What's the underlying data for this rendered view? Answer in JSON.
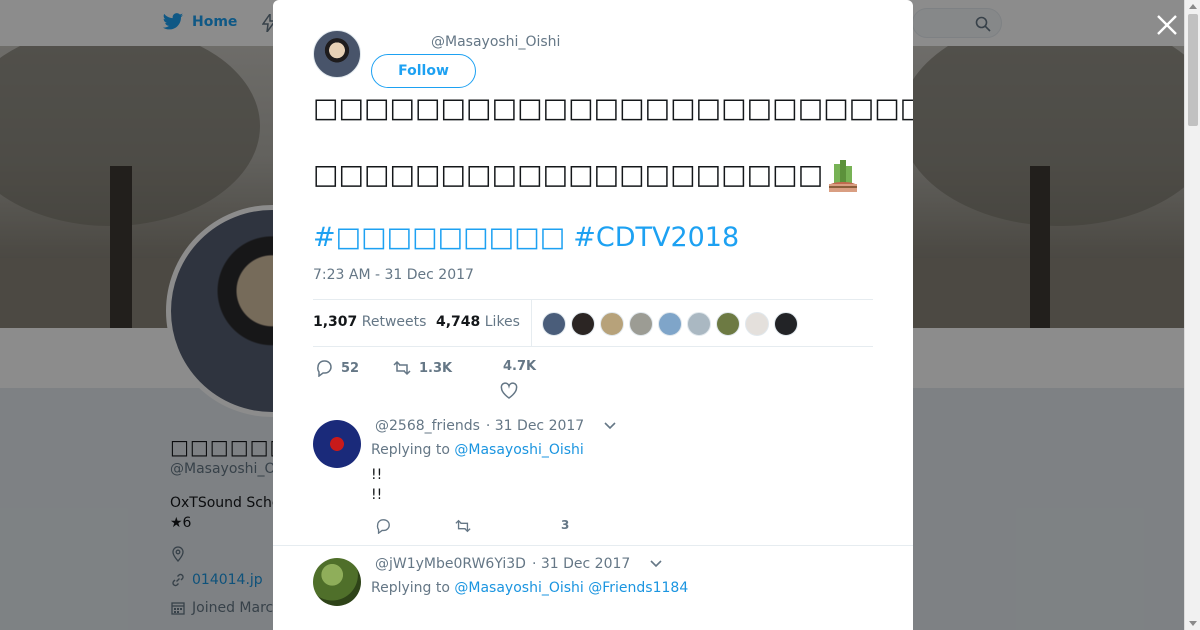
{
  "background": {
    "nav": {
      "home_label": "Home",
      "search_placeholder": ""
    },
    "profile": {
      "name": "□□□□□□□□□□",
      "handle": "@Masayoshi_O",
      "bio_line1": "OxTSound Sche",
      "bio_line2": "★6",
      "website": "014014.jp",
      "joined": "Joined Marc"
    }
  },
  "tweet": {
    "author_handle": "@Masayoshi_Oishi",
    "follow_label": "Follow",
    "text_line1": "□□□□□□□□□□□□□□□□□□□□□□□□□",
    "text_line2": "□□□□□□□□□□□□□□□□□□□□",
    "emoji": "kadomatsu",
    "hashtags": [
      "#□□□□□□□□□",
      "#CDTV2018"
    ],
    "timestamp": "7:23 AM - 31 Dec 2017",
    "stats": {
      "retweets_count": "1,307",
      "retweets_label": "Retweets",
      "likes_count": "4,748",
      "likes_label": "Likes"
    },
    "likers": [
      "#4a5d7a",
      "#2b2523",
      "#b7a27a",
      "#9c9c94",
      "#7fa5c9",
      "#aab8c2",
      "#6d7a43",
      "#e4e0dc",
      "#222326"
    ],
    "actions": {
      "replies": "52",
      "retweets": "1.3K",
      "likes": "4.7K"
    }
  },
  "replies": [
    {
      "handle": "@2568_friends",
      "date": "· 31 Dec 2017",
      "replying_prefix": "Replying to",
      "mentions": [
        "@Masayoshi_Oishi"
      ],
      "body": [
        "!!",
        "!!"
      ],
      "likes": "3"
    },
    {
      "handle": "@jW1yMbe0RW6Yi3D",
      "date": "· 31 Dec 2017",
      "replying_prefix": "Replying to",
      "mentions": [
        "@Masayoshi_Oishi",
        "@Friends1184"
      ]
    }
  ],
  "colors": {
    "accent": "#1da1f2",
    "link": "#1b95e0",
    "muted": "#657786",
    "text": "#14171a"
  },
  "icons": [
    "twitter-bird-icon",
    "search-icon",
    "close-icon",
    "reply-icon",
    "retweet-icon",
    "heart-icon",
    "chevron-down-icon",
    "location-icon",
    "link-icon",
    "calendar-icon"
  ]
}
